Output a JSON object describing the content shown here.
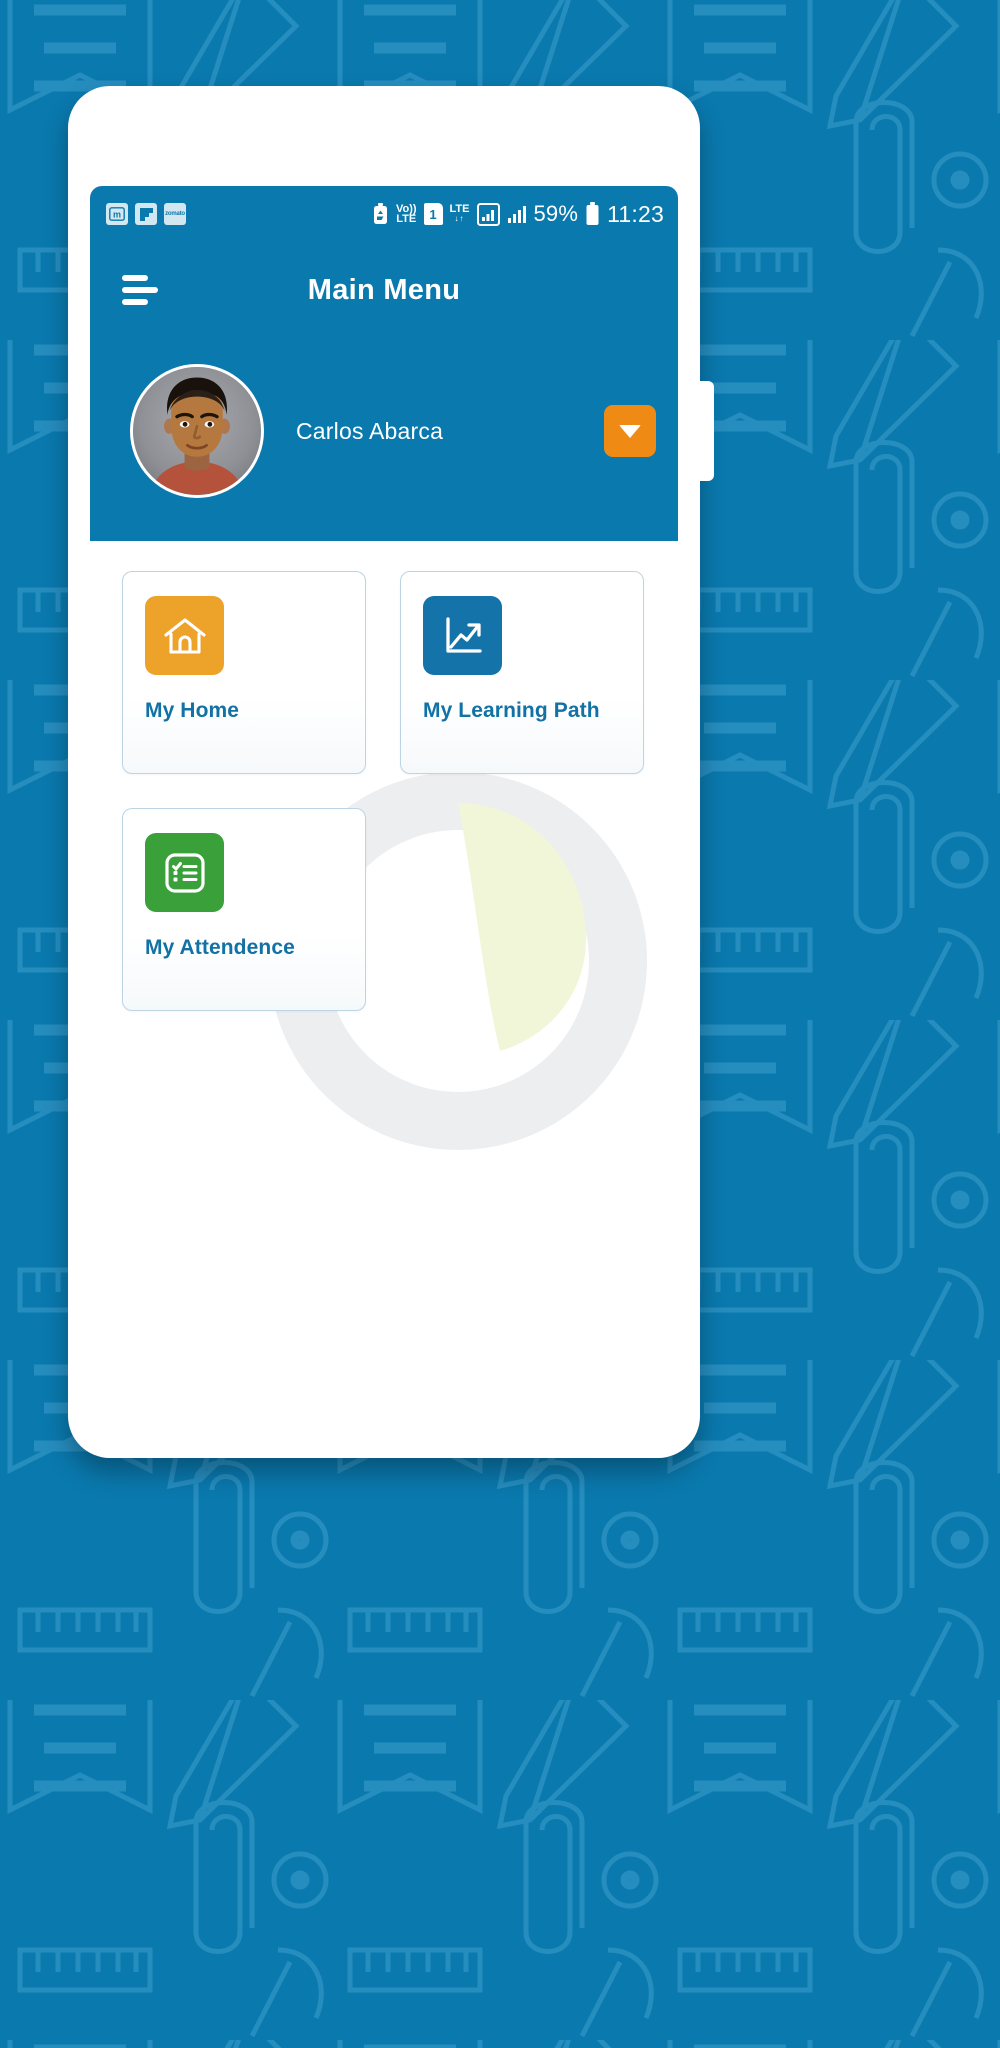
{
  "theme": {
    "brand_blue": "#0a79ae",
    "accent_orange": "#ef8b14",
    "card_label_blue": "#1271a5",
    "amber": "#eda32a",
    "green": "#3aa03a",
    "card_border": "#bcd4e3",
    "page_background": "#0a79ae"
  },
  "status_bar": {
    "notifications": [
      {
        "name": "medium-notification-icon",
        "label": "m"
      },
      {
        "name": "flipboard-notification-icon",
        "label": ""
      },
      {
        "name": "zomato-notification-icon",
        "label": "zomato"
      }
    ],
    "right_icons": [
      {
        "name": "data-saver-icon",
        "label": ""
      },
      {
        "name": "volte-icon",
        "line1": "Vo))",
        "line2": "LTE"
      },
      {
        "name": "sim-1-icon",
        "label": "1"
      },
      {
        "name": "lte-data-icon",
        "line1": "LTE",
        "line2": "↓↑"
      },
      {
        "name": "signal-sim1-icon",
        "label": ""
      },
      {
        "name": "signal-sim2-icon",
        "label": ""
      }
    ],
    "battery_percent": "59%",
    "clock": "11:23"
  },
  "header": {
    "menu_icon": "hamburger-menu-icon",
    "title": "Main Menu"
  },
  "profile": {
    "student_name": "Carlos Abarca",
    "avatar_alt": "student-photo",
    "dropdown_icon": "chevron-down-icon"
  },
  "menu_cards": [
    {
      "label": "My Home",
      "icon": "home-icon",
      "tile_color": "#eda32a",
      "name": "menu-card-my-home"
    },
    {
      "label": "My Learning Path",
      "icon": "trending-up-chart-icon",
      "tile_color": "#1473a8",
      "name": "menu-card-my-learning-path"
    },
    {
      "label": "My Attendence",
      "icon": "checklist-icon",
      "tile_color": "#3aa03a",
      "name": "menu-card-my-attendence"
    }
  ]
}
